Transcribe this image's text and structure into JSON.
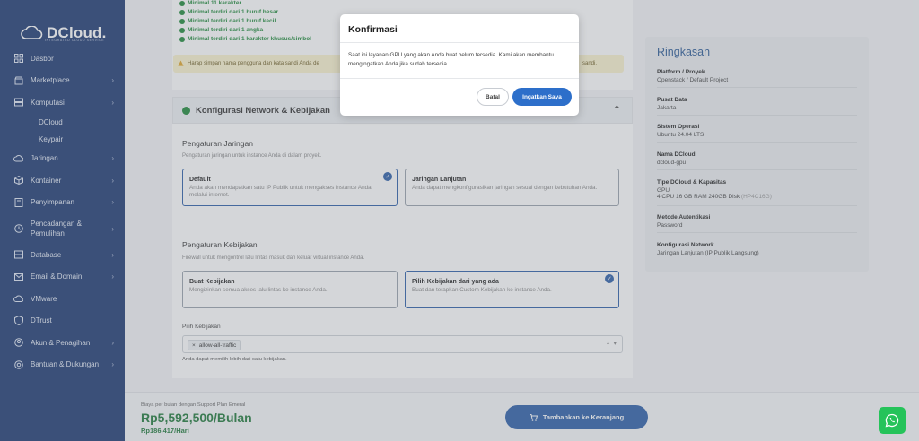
{
  "brand": {
    "name": "DCloud.",
    "tagline": "INTEGRATED CLOUD SERVICE"
  },
  "sidebar": {
    "items": [
      {
        "label": "Dasbor",
        "icon": "grid-icon",
        "chevron": false
      },
      {
        "label": "Marketplace",
        "icon": "store-icon",
        "chevron": true
      },
      {
        "label": "Komputasi",
        "icon": "server-icon",
        "chevron": true
      },
      {
        "label": "DCloud",
        "sub": true
      },
      {
        "label": "Keypair",
        "sub": true
      },
      {
        "label": "Jaringan",
        "icon": "cloud-icon",
        "chevron": true
      },
      {
        "label": "Kontainer",
        "icon": "box-icon",
        "chevron": true
      },
      {
        "label": "Penyimpanan",
        "icon": "storage-icon",
        "chevron": true
      },
      {
        "label": "Pencadangan & Pemulihan",
        "icon": "backup-icon",
        "chevron": true
      },
      {
        "label": "Database",
        "icon": "database-icon",
        "chevron": true
      },
      {
        "label": "Email & Domain",
        "icon": "mail-icon",
        "chevron": true
      },
      {
        "label": "VMware",
        "icon": "vmware-icon",
        "chevron": false
      },
      {
        "label": "DTrust",
        "icon": "shield-icon",
        "chevron": false
      },
      {
        "label": "Akun & Penagihan",
        "icon": "user-icon",
        "chevron": true
      },
      {
        "label": "Bantuan & Dukungan",
        "icon": "help-icon",
        "chevron": true
      }
    ]
  },
  "password_rules": [
    "Minimal 11 karakter",
    "Minimal terdiri dari 1 huruf besar",
    "Minimal terdiri dari 1 huruf kecil",
    "Minimal terdiri dari 1 angka",
    "Minimal terdiri dari 1 karakter khusus/simbol"
  ],
  "warning": {
    "text_left": "Harap simpan nama pengguna dan kata sandi Anda de",
    "text_right": "sandi."
  },
  "network": {
    "section_title": "Konfigurasi Network & Kebijakan",
    "network_title": "Pengaturan Jaringan",
    "network_desc": "Pengaturan jaringan untuk instance Anda di dalam proyek.",
    "options": [
      {
        "title": "Default",
        "desc": "Anda akan mendapatkan satu IP Publik untuk mengakses instance Anda melalui internet.",
        "selected": true
      },
      {
        "title": "Jaringan Lanjutan",
        "desc": "Anda dapat mengkonfigurasikan jaringan sesuai dengan kebutuhan Anda.",
        "selected": false
      }
    ],
    "policy_title": "Pengaturan Kebijakan",
    "policy_desc": "Firewall untuk mengontrol lalu lintas masuk dan keluar virtual instance Anda.",
    "policy_options": [
      {
        "title": "Buat Kebijakan",
        "desc": "Mengizinkan semua akses lalu lintas ke instance Anda.",
        "selected": false
      },
      {
        "title": "Pilih Kebijakan dari yang ada",
        "desc": "Buat dan terapkan Custom Kebijakan ke instance Anda.",
        "selected": true
      }
    ],
    "select_label": "Pilih Kebijakan",
    "select_chip": "allow-all-traffic",
    "select_hint": "Anda dapat memilih lebih dari satu kebijakan."
  },
  "summary": {
    "title": "Ringkasan",
    "rows": [
      {
        "key": "Platform / Proyek",
        "value": "Openstack / Default Project"
      },
      {
        "key": "Pusat Data",
        "value": "Jakarta"
      },
      {
        "key": "Sistem Operasi",
        "value": "Ubuntu 24.04 LTS"
      },
      {
        "key": "Nama DCloud",
        "value": "dcloud-gpu"
      },
      {
        "key": "Tipe DCloud & Kapasitas",
        "value": "GPU",
        "value2": "4 CPU 16 GB RAM 240GB Disk",
        "value2_muted": "(HP4C16G)"
      },
      {
        "key": "Metode Autentikasi",
        "value": "Password"
      },
      {
        "key": "Konfigurasi Network",
        "value": "Jaringan Lanjutan (IP Publik Langsung)"
      }
    ]
  },
  "bottom": {
    "note": "Biaya per bulan dengan Support Plan Emeral",
    "price_month": "Rp5,592,500/Bulan",
    "price_day": "Rp186,417/Hari",
    "cart_label": "Tambahkan ke Keranjang"
  },
  "modal": {
    "title": "Konfirmasi",
    "body": "Saat ini layanan GPU yang akan Anda buat belum tersedia. Kami akan membantu mengingatkan Anda jika sudah tersedia.",
    "cancel_label": "Batal",
    "confirm_label": "Ingatkan Saya"
  },
  "colors": {
    "sidebar": "#1e3a72",
    "primary": "#2d5fa8",
    "success": "#1f7a3a",
    "whatsapp": "#25c35a"
  }
}
